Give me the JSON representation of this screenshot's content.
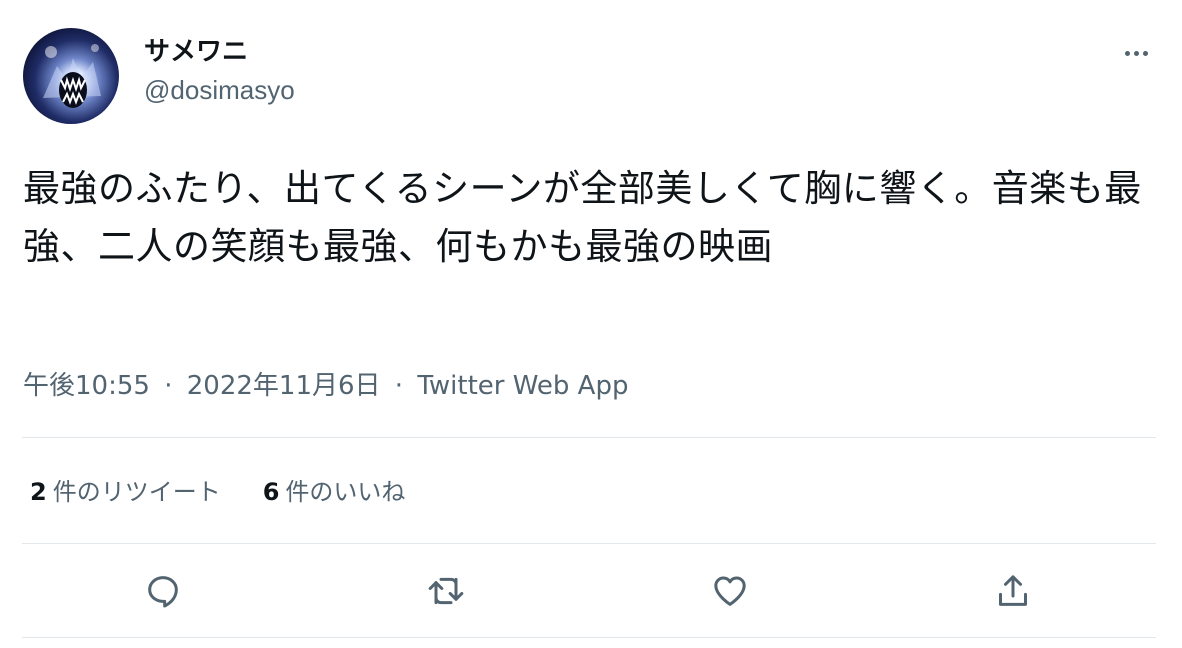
{
  "user": {
    "display_name": "サメワニ",
    "handle": "@dosimasyo"
  },
  "tweet": {
    "text": "最強のふたり、出てくるシーンが全部美しくて胸に響く。音楽も最強、二人の笑顔も最強、何もかも最強の映画",
    "time": "午後10:55",
    "separator": "·",
    "date": "2022年11月6日",
    "source": "Twitter Web App"
  },
  "stats": {
    "retweets_count": "2",
    "retweets_label": "件のリツイート",
    "likes_count": "6",
    "likes_label": "件のいいね"
  },
  "icons": {
    "more": "more-icon",
    "reply": "reply-icon",
    "retweet": "retweet-icon",
    "like": "heart-icon",
    "share": "share-icon"
  },
  "colors": {
    "text_primary": "#0f1419",
    "text_secondary": "#536471",
    "divider": "#e3e8ec"
  }
}
